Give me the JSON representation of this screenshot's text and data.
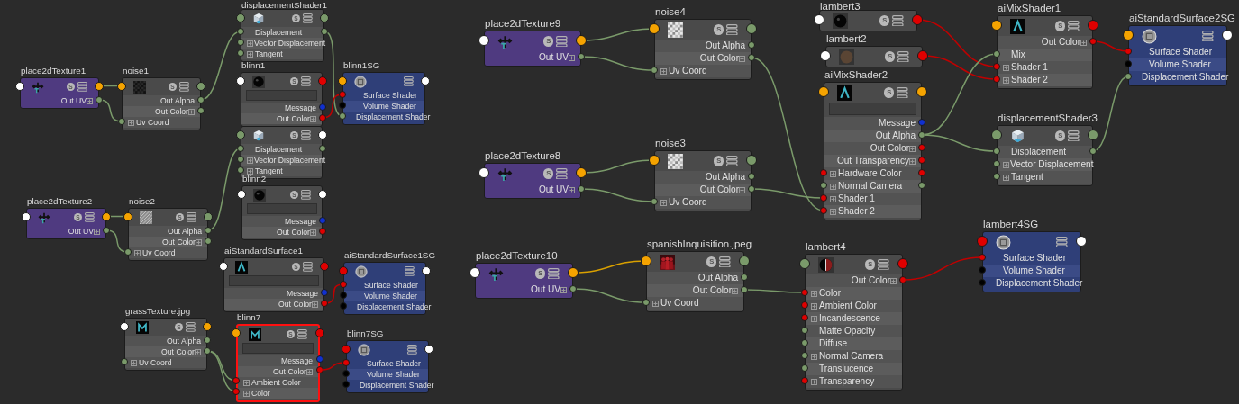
{
  "nodes": [
    {
      "title": "place2dTexture1",
      "kind": "place2d",
      "badge": "S",
      "swatch": false,
      "selected": false,
      "rows": [
        {
          "label": "Out UV",
          "expand": true
        }
      ]
    },
    {
      "title": "place2dTexture2",
      "kind": "place2d",
      "badge": "S",
      "swatch": false,
      "selected": false,
      "rows": [
        {
          "label": "Out UV",
          "expand": true
        }
      ]
    },
    {
      "title": "noise1",
      "kind": "utility",
      "badge": "S",
      "swatch": false,
      "selected": false,
      "rows": [
        {
          "label": "Out Alpha",
          "expand": false
        },
        {
          "label": "Out Color",
          "expand": true
        },
        {
          "label": "Uv Coord",
          "expand": true
        }
      ]
    },
    {
      "title": "noise2",
      "kind": "utility",
      "badge": "S",
      "swatch": false,
      "selected": false,
      "rows": [
        {
          "label": "Out Alpha",
          "expand": false
        },
        {
          "label": "Out Color",
          "expand": true
        },
        {
          "label": "Uv Coord",
          "expand": true
        }
      ]
    },
    {
      "title": "grassTexture.jpg",
      "kind": "utility",
      "badge": "S",
      "swatch": false,
      "selected": false,
      "rows": [
        {
          "label": "Out Alpha",
          "expand": false
        },
        {
          "label": "Out Color",
          "expand": true
        },
        {
          "label": "Uv Coord",
          "expand": true
        }
      ]
    },
    {
      "title": "displacementShader1",
      "kind": "utility",
      "badge": "S",
      "swatch": false,
      "selected": false,
      "rows": [
        {
          "label": "Displacement",
          "expand": false
        },
        {
          "label": "Vector Displacement",
          "expand": true
        },
        {
          "label": "Tangent",
          "expand": true
        }
      ]
    },
    {
      "title": "blinn1",
      "kind": "utility",
      "badge": "S",
      "swatch": true,
      "selected": false,
      "rows": [
        {
          "label": "Message",
          "expand": false
        },
        {
          "label": "Out Color",
          "expand": true
        }
      ]
    },
    {
      "kind": "utility",
      "badge": "S",
      "swatch": false,
      "selected": false,
      "rows": [
        {
          "label": "Displacement",
          "expand": false
        },
        {
          "label": "Vector Displacement",
          "expand": true
        },
        {
          "label": "Tangent",
          "expand": true
        }
      ]
    },
    {
      "title": "blinn2",
      "kind": "utility",
      "badge": "S",
      "swatch": true,
      "selected": false,
      "rows": [
        {
          "label": "Message",
          "expand": false
        },
        {
          "label": "Out Color",
          "expand": true
        }
      ]
    },
    {
      "title": "aiStandardSurface1",
      "kind": "utility",
      "badge": "S",
      "swatch": true,
      "selected": false,
      "rows": [
        {
          "label": "Message",
          "expand": false
        },
        {
          "label": "Out Color",
          "expand": true
        }
      ]
    },
    {
      "title": "blinn7",
      "kind": "utility",
      "badge": "S",
      "swatch": true,
      "selected": true,
      "rows": [
        {
          "label": "Message",
          "expand": false
        },
        {
          "label": "Out Color",
          "expand": true
        },
        {
          "label": "Ambient Color",
          "expand": true
        },
        {
          "label": "Color",
          "expand": true
        }
      ]
    },
    {
      "title": "blinn1SG",
      "kind": "sg",
      "swatch": false,
      "selected": false,
      "rows": [
        {
          "label": "Surface Shader",
          "expand": false
        },
        {
          "label": "Volume Shader",
          "expand": false
        },
        {
          "label": "Displacement Shader",
          "expand": false
        }
      ]
    },
    {
      "title": "aiStandardSurface1SG",
      "kind": "sg",
      "swatch": false,
      "selected": false,
      "rows": [
        {
          "label": "Surface Shader",
          "expand": false
        },
        {
          "label": "Volume Shader",
          "expand": false
        },
        {
          "label": "Displacement Shader",
          "expand": false
        }
      ]
    },
    {
      "title": "blinn7SG",
      "kind": "sg",
      "swatch": false,
      "selected": false,
      "rows": [
        {
          "label": "Surface Shader",
          "expand": false
        },
        {
          "label": "Volume Shader",
          "expand": false
        },
        {
          "label": "Displacement Shader",
          "expand": false
        }
      ]
    },
    {
      "title": "place2dTexture9",
      "kind": "place2d",
      "badge": "S",
      "swatch": false,
      "selected": false,
      "rows": [
        {
          "label": "Out UV",
          "expand": true
        }
      ]
    },
    {
      "title": "place2dTexture8",
      "kind": "place2d",
      "badge": "S",
      "swatch": false,
      "selected": false,
      "rows": [
        {
          "label": "Out UV",
          "expand": true
        }
      ]
    },
    {
      "title": "place2dTexture10",
      "kind": "place2d",
      "badge": "S",
      "swatch": false,
      "selected": false,
      "rows": [
        {
          "label": "Out UV",
          "expand": true
        }
      ]
    },
    {
      "title": "noise4",
      "kind": "utility",
      "badge": "S",
      "swatch": false,
      "selected": false,
      "rows": [
        {
          "label": "Out Alpha",
          "expand": false
        },
        {
          "label": "Out Color",
          "expand": true
        },
        {
          "label": "Uv Coord",
          "expand": true
        }
      ]
    },
    {
      "title": "noise3",
      "kind": "utility",
      "badge": "S",
      "swatch": false,
      "selected": false,
      "rows": [
        {
          "label": "Out Alpha",
          "expand": false
        },
        {
          "label": "Out Color",
          "expand": true
        },
        {
          "label": "Uv Coord",
          "expand": true
        }
      ]
    },
    {
      "title": "spanishInquisition.jpeg",
      "kind": "utility",
      "badge": "S",
      "swatch": false,
      "selected": false,
      "rows": [
        {
          "label": "Out Alpha",
          "expand": false
        },
        {
          "label": "Out Color",
          "expand": true
        },
        {
          "label": "Uv Coord",
          "expand": true
        }
      ]
    },
    {
      "title": "lambert3",
      "kind": "utility",
      "badge": "S",
      "swatch": false,
      "selected": false
    },
    {
      "title": "lambert2",
      "kind": "utility",
      "badge": "S",
      "swatch": false,
      "selected": false
    },
    {
      "title": "aiMixShader2",
      "kind": "utility",
      "badge": "S",
      "swatch": true,
      "selected": false,
      "rows": [
        {
          "label": "Message",
          "expand": false
        },
        {
          "label": "Out Alpha",
          "expand": false
        },
        {
          "label": "Out Color",
          "expand": true
        },
        {
          "label": "Out Transparency",
          "expand": true
        },
        {
          "label": "Hardware Color",
          "expand": true
        },
        {
          "label": "Normal Camera",
          "expand": true
        },
        {
          "label": "Shader 1",
          "expand": true
        },
        {
          "label": "Shader 2",
          "expand": true
        }
      ]
    },
    {
      "title": "lambert4",
      "kind": "utility",
      "badge": "S",
      "swatch": false,
      "selected": false,
      "rows": [
        {
          "label": "Out Color",
          "expand": true
        },
        {
          "label": "Color",
          "expand": true
        },
        {
          "label": "Ambient Color",
          "expand": true
        },
        {
          "label": "Incandescence",
          "expand": true
        },
        {
          "label": "Matte Opacity",
          "expand": false
        },
        {
          "label": "Diffuse",
          "expand": false
        },
        {
          "label": "Normal Camera",
          "expand": true
        },
        {
          "label": "Translucence",
          "expand": false
        },
        {
          "label": "Transparency",
          "expand": true
        }
      ]
    },
    {
      "title": "aiMixShader1",
      "kind": "utility",
      "badge": "S",
      "swatch": false,
      "selected": false,
      "rows": [
        {
          "label": "Out Color",
          "expand": true
        },
        {
          "label": "Mix",
          "expand": false
        },
        {
          "label": "Shader 1",
          "expand": true
        },
        {
          "label": "Shader 2",
          "expand": true
        }
      ]
    },
    {
      "title": "displacementShader3",
      "kind": "utility",
      "badge": "S",
      "swatch": false,
      "selected": false,
      "rows": [
        {
          "label": "Displacement",
          "expand": false
        },
        {
          "label": "Vector Displacement",
          "expand": true
        },
        {
          "label": "Tangent",
          "expand": true
        }
      ]
    },
    {
      "title": "lambert4SG",
      "kind": "sg",
      "swatch": false,
      "selected": false,
      "rows": [
        {
          "label": "Surface Shader",
          "expand": false
        },
        {
          "label": "Volume Shader",
          "expand": false
        },
        {
          "label": "Displacement Shader",
          "expand": false
        }
      ]
    },
    {
      "title": "aiStandardSurface2SG",
      "kind": "sg",
      "swatch": false,
      "selected": false,
      "rows": [
        {
          "label": "Surface Shader",
          "expand": false
        },
        {
          "label": "Volume Shader",
          "expand": false
        },
        {
          "label": "Displacement Shader",
          "expand": false
        }
      ]
    }
  ]
}
